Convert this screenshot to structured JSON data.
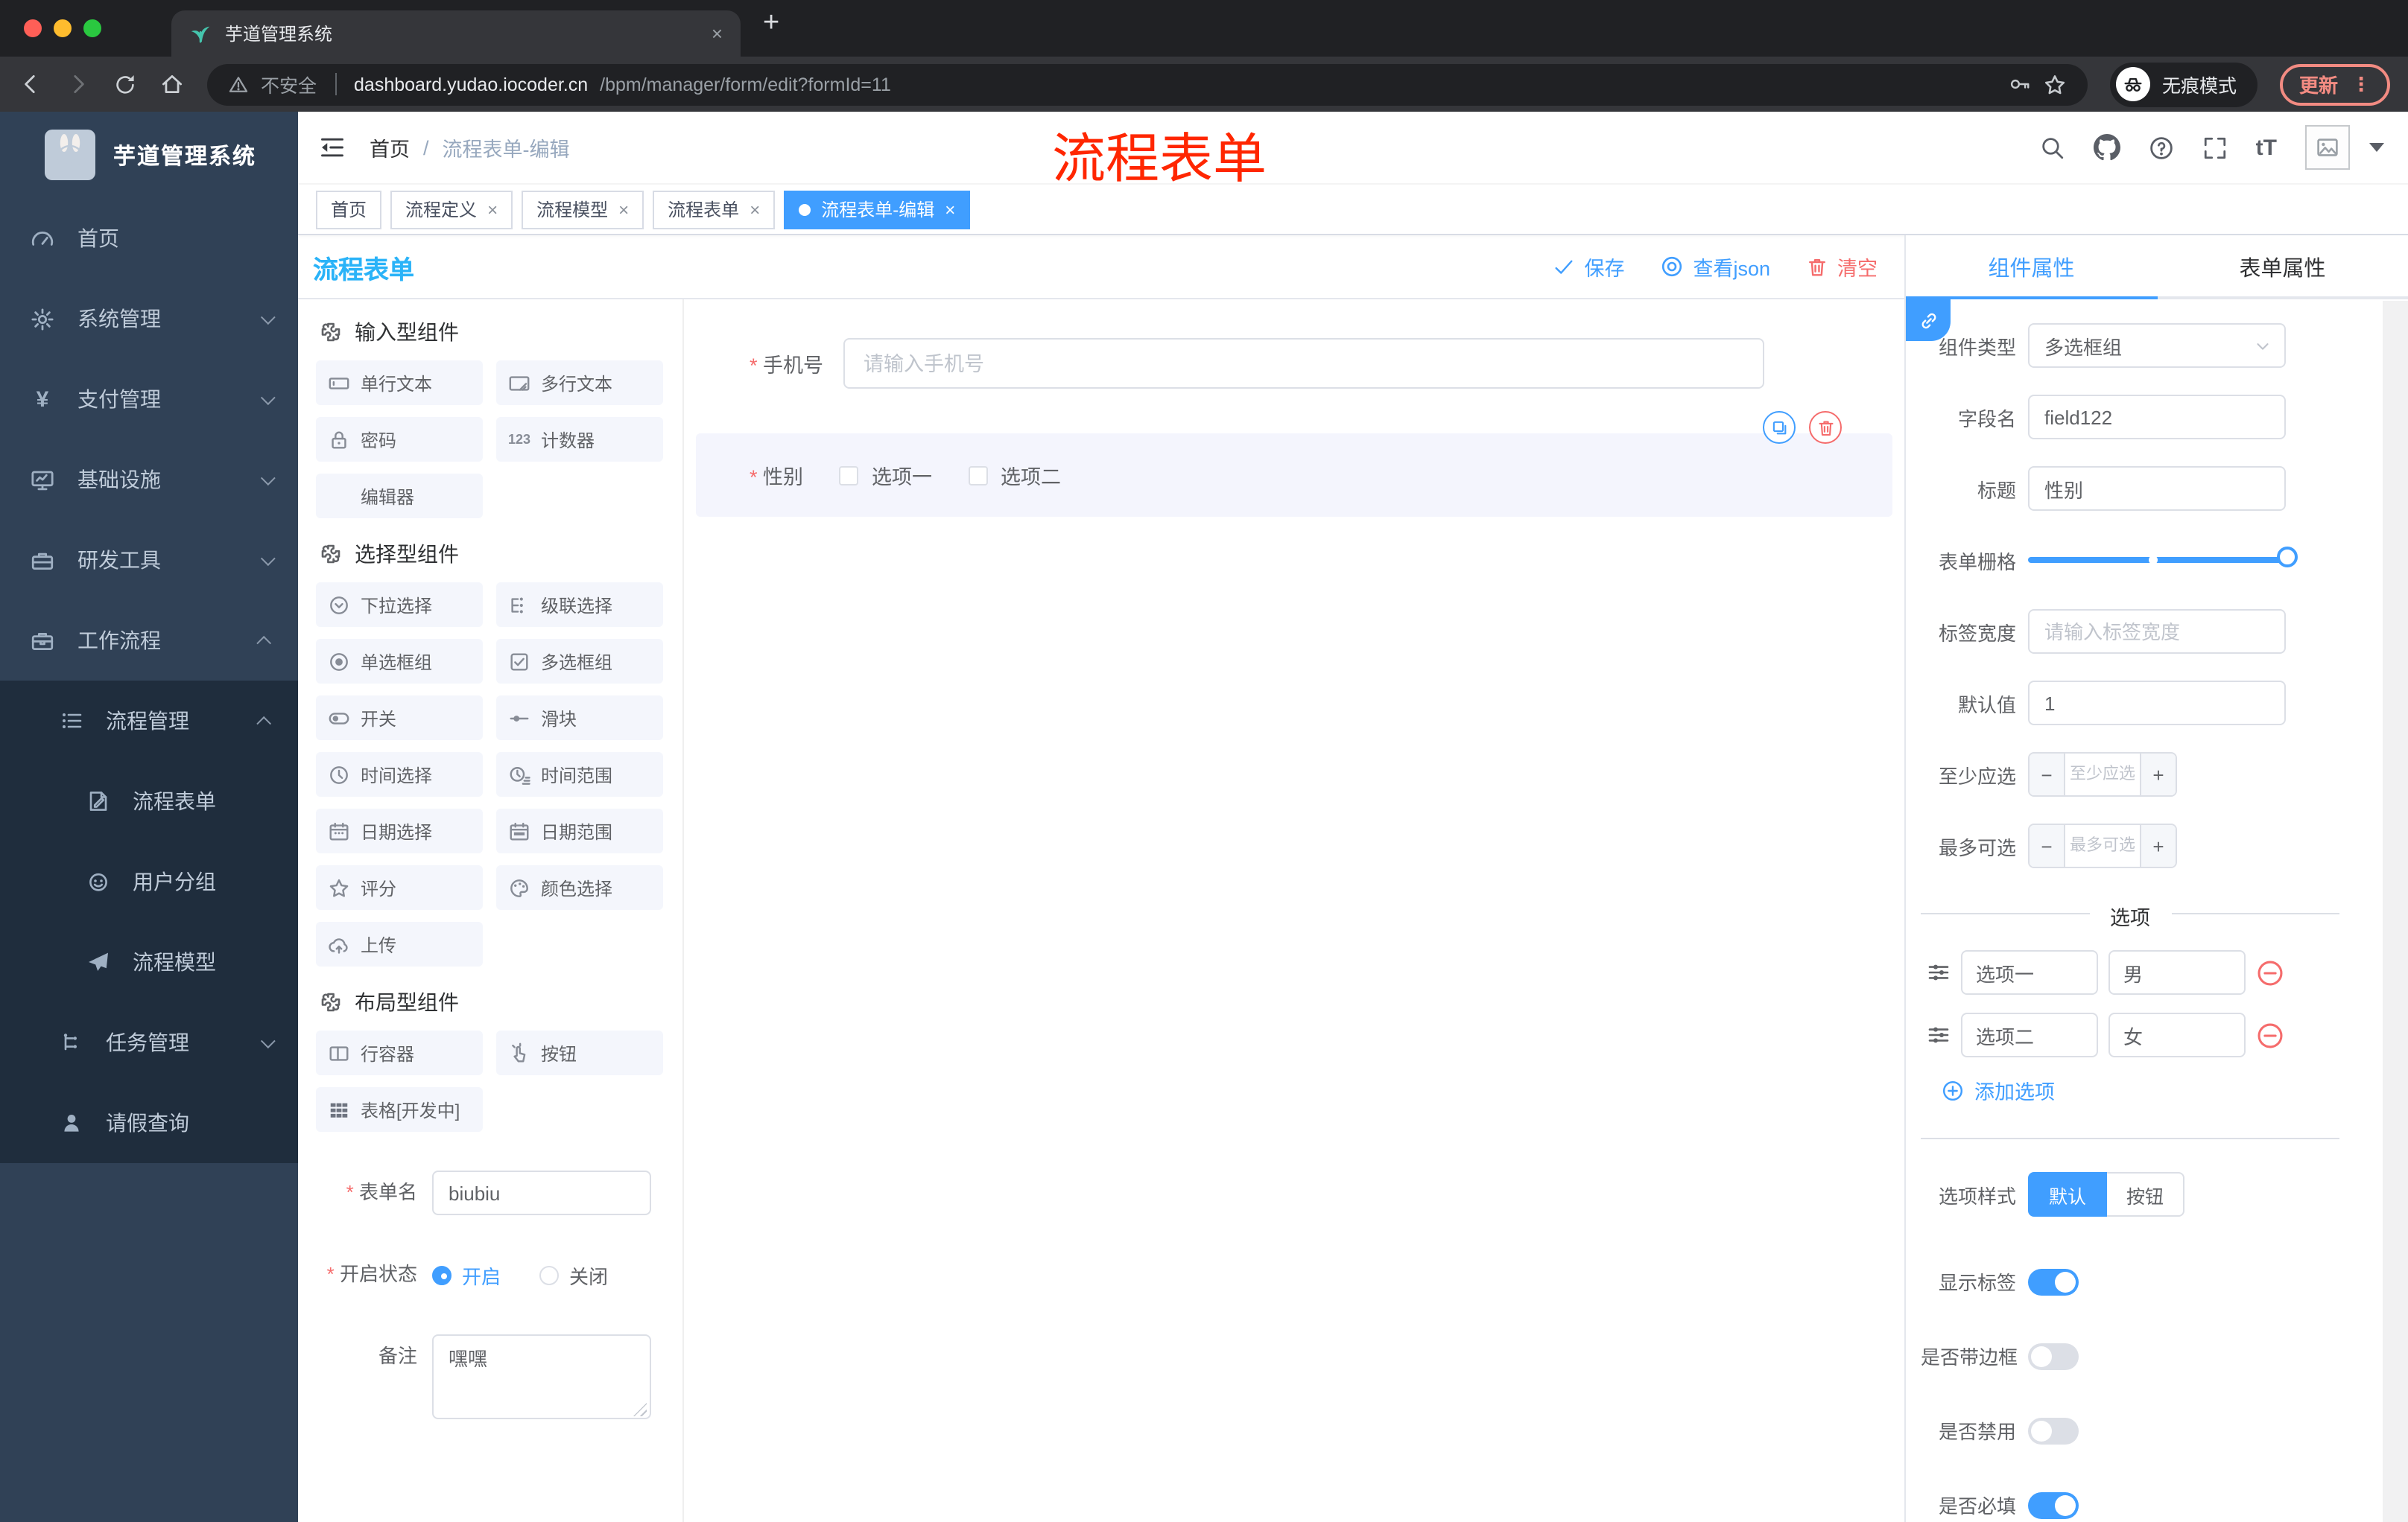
{
  "glyphs": {
    "close": "×",
    "new_tab": "+",
    "plus": "+",
    "minus": "−",
    "dots_vertical": "⋮",
    "num123": "123",
    "font_size": "tT",
    "yen": "¥"
  },
  "browser": {
    "tab_title": "芋道管理系统",
    "insecure_label": "不安全",
    "url_host": "dashboard.yudao.iocoder.cn",
    "url_path": "/bpm/manager/form/edit?formId=11",
    "incognito_label": "无痕模式",
    "update_label": "更新"
  },
  "annotation": {
    "text": "流程表单"
  },
  "header": {
    "breadcrumb_home": "首页",
    "breadcrumb_sep": "/",
    "breadcrumb_current": "流程表单-编辑"
  },
  "tags": [
    {
      "label": "首页"
    },
    {
      "label": "流程定义"
    },
    {
      "label": "流程模型"
    },
    {
      "label": "流程表单"
    },
    {
      "label": "流程表单-编辑"
    }
  ],
  "sidebar": {
    "title": "芋道管理系统",
    "menu": [
      {
        "label": "首页"
      },
      {
        "label": "系统管理"
      },
      {
        "label": "支付管理"
      },
      {
        "label": "基础设施"
      },
      {
        "label": "研发工具"
      },
      {
        "label": "工作流程"
      }
    ],
    "submenu": [
      {
        "label": "流程管理"
      },
      {
        "label": "流程表单"
      },
      {
        "label": "用户分组"
      },
      {
        "label": "流程模型"
      },
      {
        "label": "任务管理"
      },
      {
        "label": "请假查询"
      }
    ]
  },
  "designer": {
    "title": "流程表单",
    "save_label": "保存",
    "view_json_label": "查看json",
    "clear_label": "清空"
  },
  "components": {
    "groups": [
      {
        "title": "输入型组件",
        "items": [
          {
            "label": "单行文本"
          },
          {
            "label": "多行文本"
          },
          {
            "label": "密码"
          },
          {
            "label": "计数器"
          },
          {
            "label": "编辑器"
          }
        ]
      },
      {
        "title": "选择型组件",
        "items": [
          {
            "label": "下拉选择"
          },
          {
            "label": "级联选择"
          },
          {
            "label": "单选框组"
          },
          {
            "label": "多选框组"
          },
          {
            "label": "开关"
          },
          {
            "label": "滑块"
          },
          {
            "label": "时间选择"
          },
          {
            "label": "时间范围"
          },
          {
            "label": "日期选择"
          },
          {
            "label": "日期范围"
          },
          {
            "label": "评分"
          },
          {
            "label": "颜色选择"
          },
          {
            "label": "上传"
          }
        ]
      },
      {
        "title": "布局型组件",
        "items": [
          {
            "label": "行容器"
          },
          {
            "label": "按钮"
          },
          {
            "label": "表格[开发中]"
          }
        ]
      }
    ]
  },
  "form_meta": {
    "name_label": "表单名",
    "name_value": "biubiu",
    "status_label": "开启状态",
    "status_on": "开启",
    "status_off": "关闭",
    "remark_label": "备注",
    "remark_value": "嘿嘿"
  },
  "canvas": {
    "phone_label": "手机号",
    "phone_placeholder": "请输入手机号",
    "gender_label": "性别",
    "gender_options": [
      {
        "label": "选项一"
      },
      {
        "label": "选项二"
      }
    ]
  },
  "panel": {
    "tab_component": "组件属性",
    "tab_form": "表单属性",
    "type_label": "组件类型",
    "type_value": "多选框组",
    "field_label": "字段名",
    "field_value": "field122",
    "title_label": "标题",
    "title_value": "性别",
    "grid_label": "表单栅格",
    "labelwidth_label": "标签宽度",
    "labelwidth_placeholder": "请输入标签宽度",
    "default_label": "默认值",
    "default_value": "1",
    "min_label": "至少应选",
    "min_placeholder": "至少应选",
    "max_label": "最多可选",
    "max_placeholder": "最多可选",
    "options_divider": "选项",
    "options": [
      {
        "label": "选项一",
        "value": "男"
      },
      {
        "label": "选项二",
        "value": "女"
      }
    ],
    "add_option": "添加选项",
    "style_label": "选项样式",
    "style_default": "默认",
    "style_button": "按钮",
    "toggle_show_label": "显示标签",
    "toggle_border": "是否带边框",
    "toggle_disabled": "是否禁用",
    "toggle_required": "是否必填"
  }
}
